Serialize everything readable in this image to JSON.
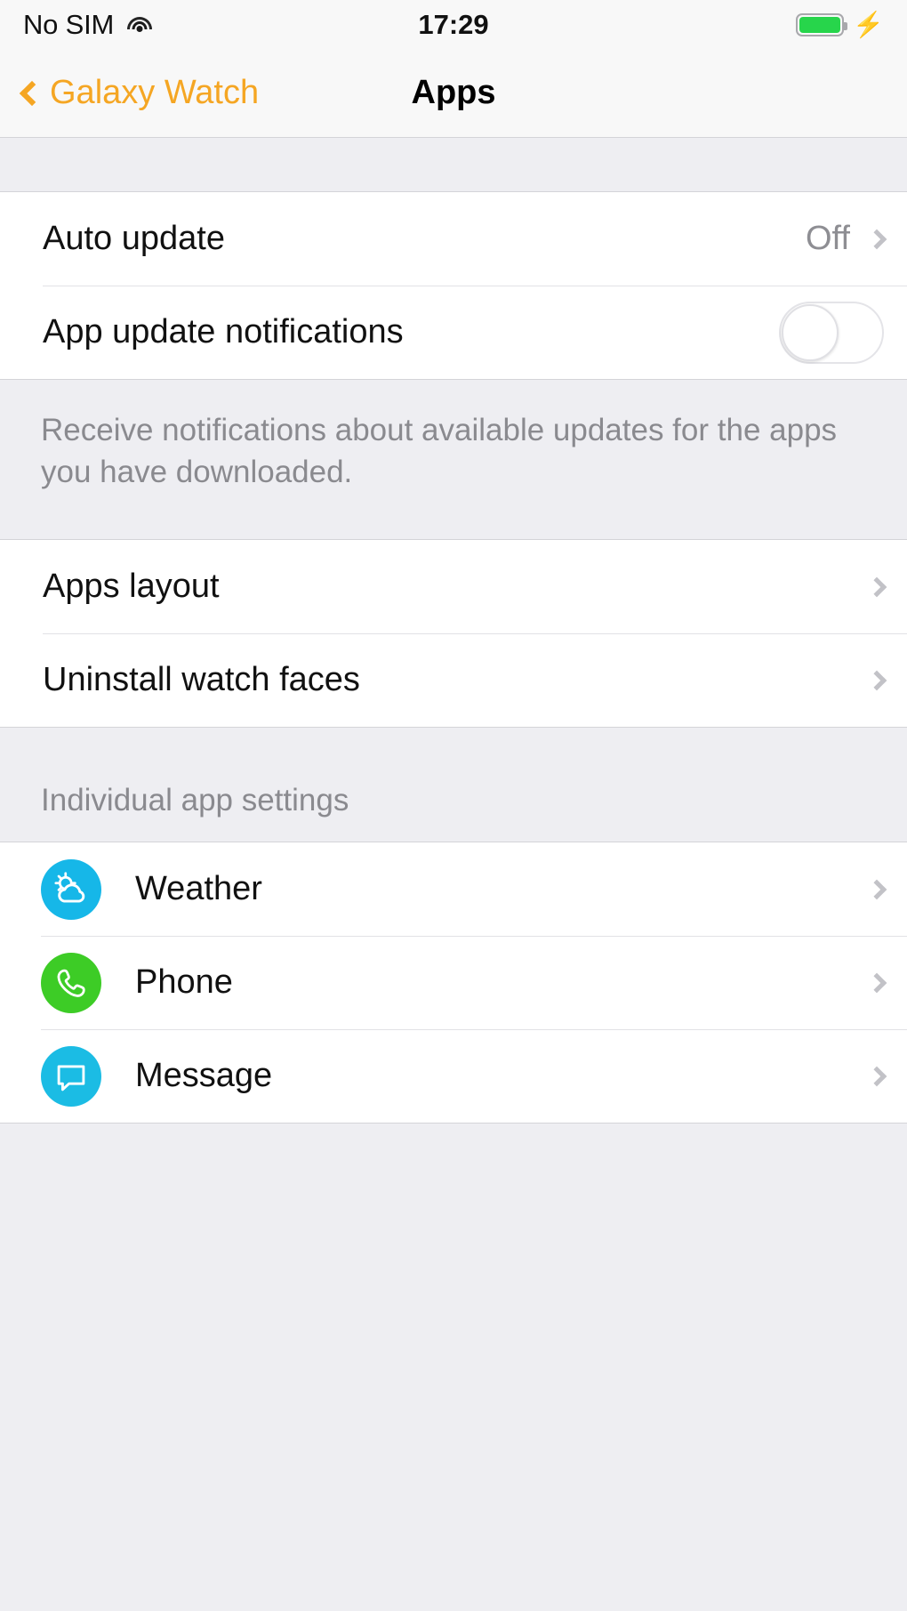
{
  "status_bar": {
    "carrier": "No SIM",
    "wifi_icon": "wifi-icon",
    "time": "17:29",
    "battery_icon": "battery-full-icon",
    "charging_icon": "charging-bolt-icon"
  },
  "nav": {
    "back_label": "Galaxy Watch",
    "back_icon": "chevron-left-icon",
    "title": "Apps"
  },
  "update_group": {
    "auto_update": {
      "label": "Auto update",
      "value": "Off",
      "chevron_icon": "chevron-right-icon"
    },
    "app_update_notifications": {
      "label": "App update notifications",
      "toggle_state": "off"
    }
  },
  "update_footnote": "Receive notifications about available updates for the apps you have downloaded.",
  "manage_group": {
    "rows": [
      {
        "label": "Apps layout",
        "chevron_icon": "chevron-right-icon"
      },
      {
        "label": "Uninstall watch faces",
        "chevron_icon": "chevron-right-icon"
      }
    ]
  },
  "individual_apps": {
    "header": "Individual app settings",
    "rows": [
      {
        "label": "Weather",
        "icon": "weather-icon",
        "icon_color": "#16b7e8",
        "chevron_icon": "chevron-right-icon"
      },
      {
        "label": "Phone",
        "icon": "phone-icon",
        "icon_color": "#3dcc26",
        "chevron_icon": "chevron-right-icon"
      },
      {
        "label": "Message",
        "icon": "message-icon",
        "icon_color": "#1bbce4",
        "chevron_icon": "chevron-right-icon"
      }
    ]
  },
  "colors": {
    "accent": "#f5a623",
    "background": "#eeeef2",
    "row_background": "#ffffff",
    "secondary_text": "#8e8e93"
  }
}
